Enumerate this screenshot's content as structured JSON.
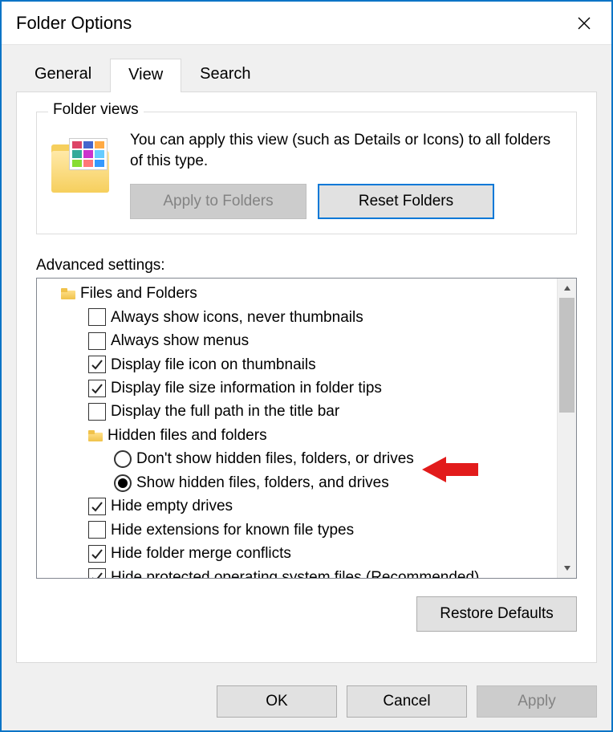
{
  "window": {
    "title": "Folder Options"
  },
  "tabs": {
    "general": "General",
    "view": "View",
    "search": "Search",
    "active": "view"
  },
  "folderViews": {
    "legend": "Folder views",
    "desc": "You can apply this view (such as Details or Icons) to all folders of this type.",
    "apply": "Apply to Folders",
    "reset": "Reset Folders"
  },
  "advanced": {
    "label": "Advanced settings:",
    "root": "Files and Folders",
    "hiddenGroup": "Hidden files and folders",
    "items": {
      "always_icons": {
        "label": "Always show icons, never thumbnails",
        "checked": false
      },
      "always_menus": {
        "label": "Always show menus",
        "checked": false
      },
      "display_icon_thumb": {
        "label": "Display file icon on thumbnails",
        "checked": true
      },
      "display_size_tips": {
        "label": "Display file size information in folder tips",
        "checked": true
      },
      "display_full_path": {
        "label": "Display the full path in the title bar",
        "checked": false
      },
      "radio_dont_show": {
        "label": "Don't show hidden files, folders, or drives",
        "selected": false
      },
      "radio_show": {
        "label": "Show hidden files, folders, and drives",
        "selected": true
      },
      "hide_empty_drives": {
        "label": "Hide empty drives",
        "checked": true
      },
      "hide_ext": {
        "label": "Hide extensions for known file types",
        "checked": false
      },
      "hide_merge": {
        "label": "Hide folder merge conflicts",
        "checked": true
      },
      "hide_protected": {
        "label": "Hide protected operating system files (Recommended)",
        "checked": true
      }
    },
    "restore": "Restore Defaults"
  },
  "buttons": {
    "ok": "OK",
    "cancel": "Cancel",
    "apply": "Apply"
  }
}
